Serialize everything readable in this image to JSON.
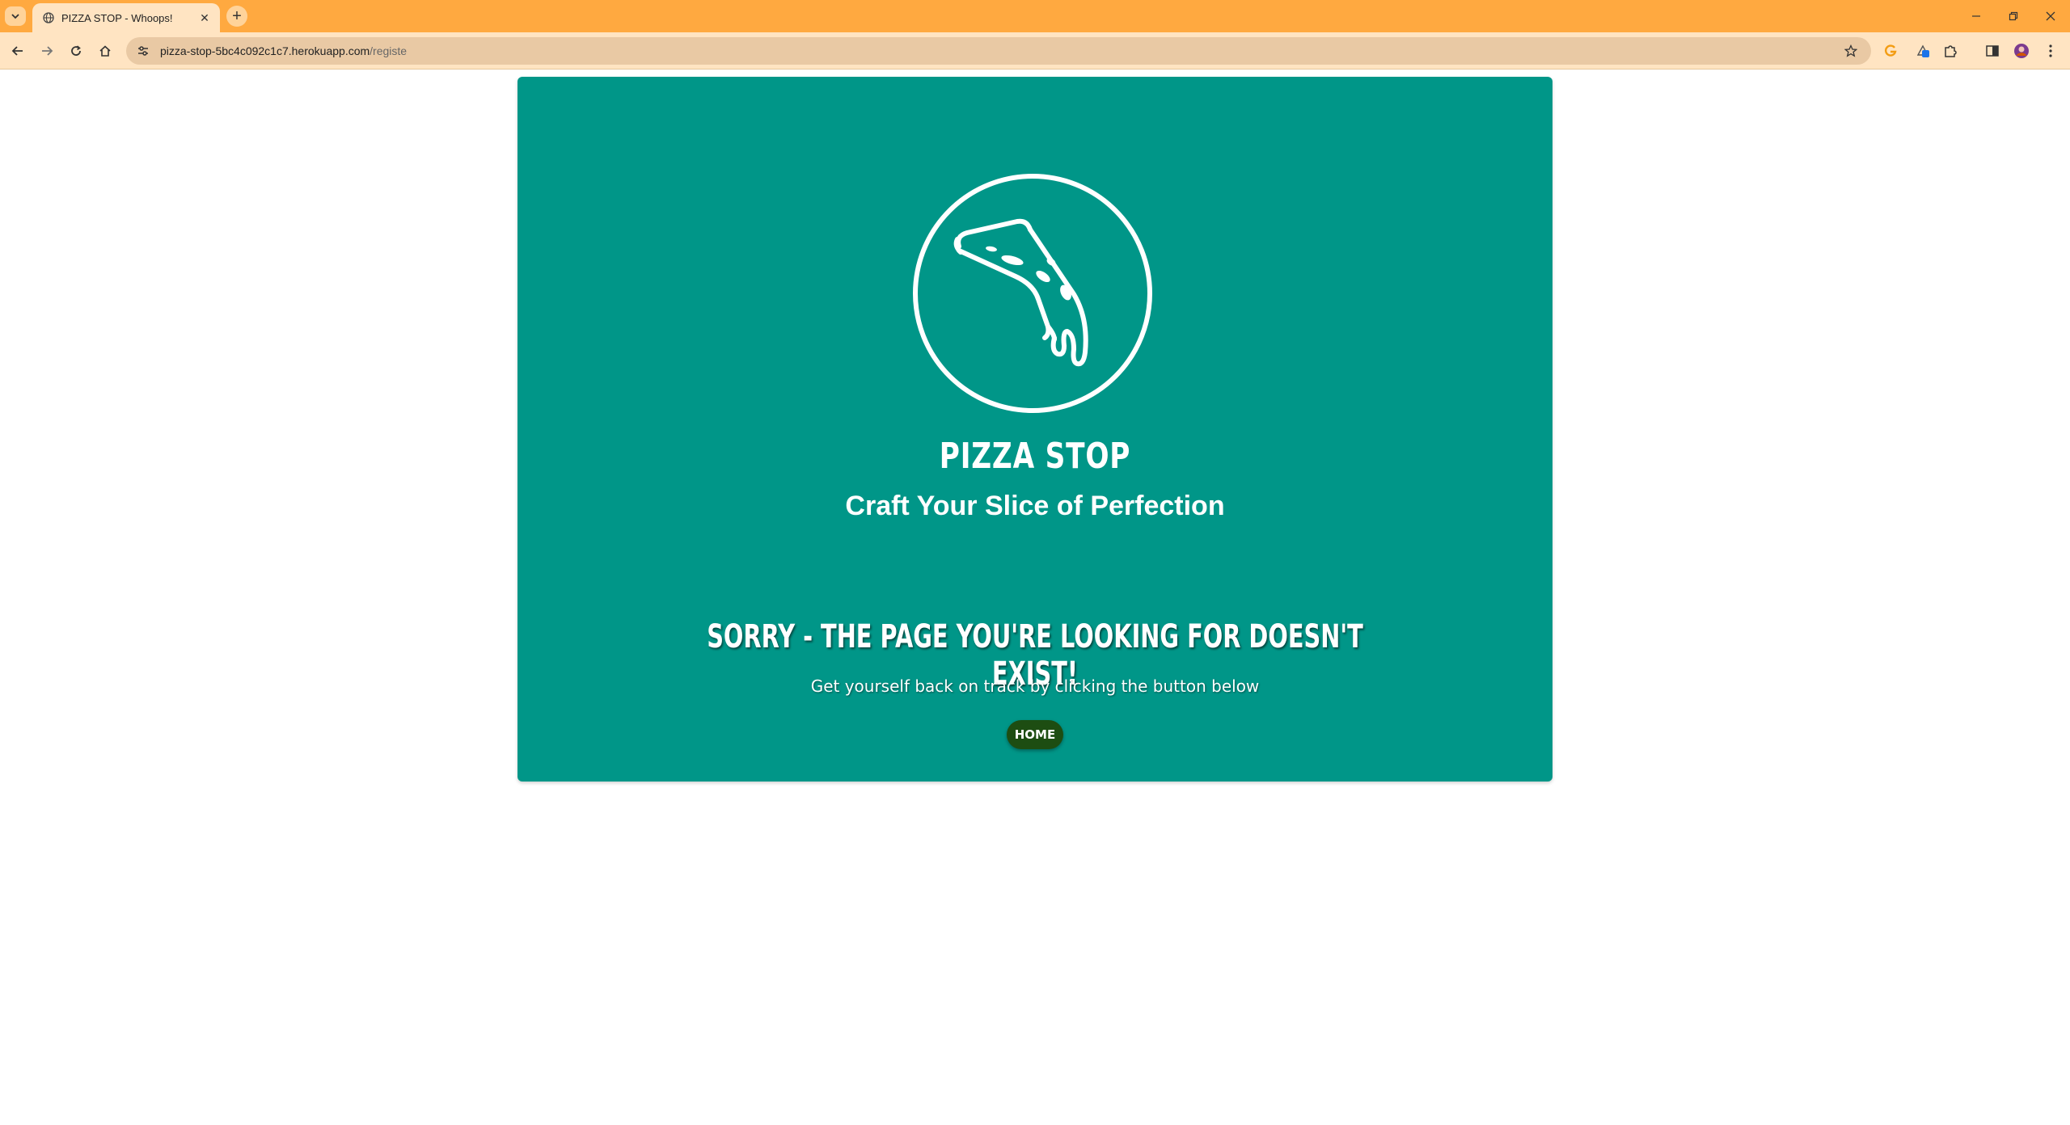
{
  "browser": {
    "tab_title": "PIZZA STOP - Whoops!",
    "tab_close": "✕",
    "new_tab": "+",
    "url_host": "pizza-stop-5bc4c092c1c7.herokuapp.com",
    "url_path": "/registe",
    "window_controls": [
      "minimize-icon",
      "restore-icon",
      "close-icon"
    ]
  },
  "header": {
    "brand": "PIZZA STOP",
    "tagline": "Craft Your Slice of Perfection",
    "logo_icon": "pizza-slice-icon"
  },
  "error": {
    "heading": "Sorry - The page you're looking for doesn't exist!",
    "message": "Get yourself back on track by clicking the button below",
    "button_label": "Home"
  },
  "colors": {
    "chrome_accent": "#ffa940",
    "card_background": "#009688",
    "button_background": "#1d4d12",
    "text": "#ffffff"
  }
}
